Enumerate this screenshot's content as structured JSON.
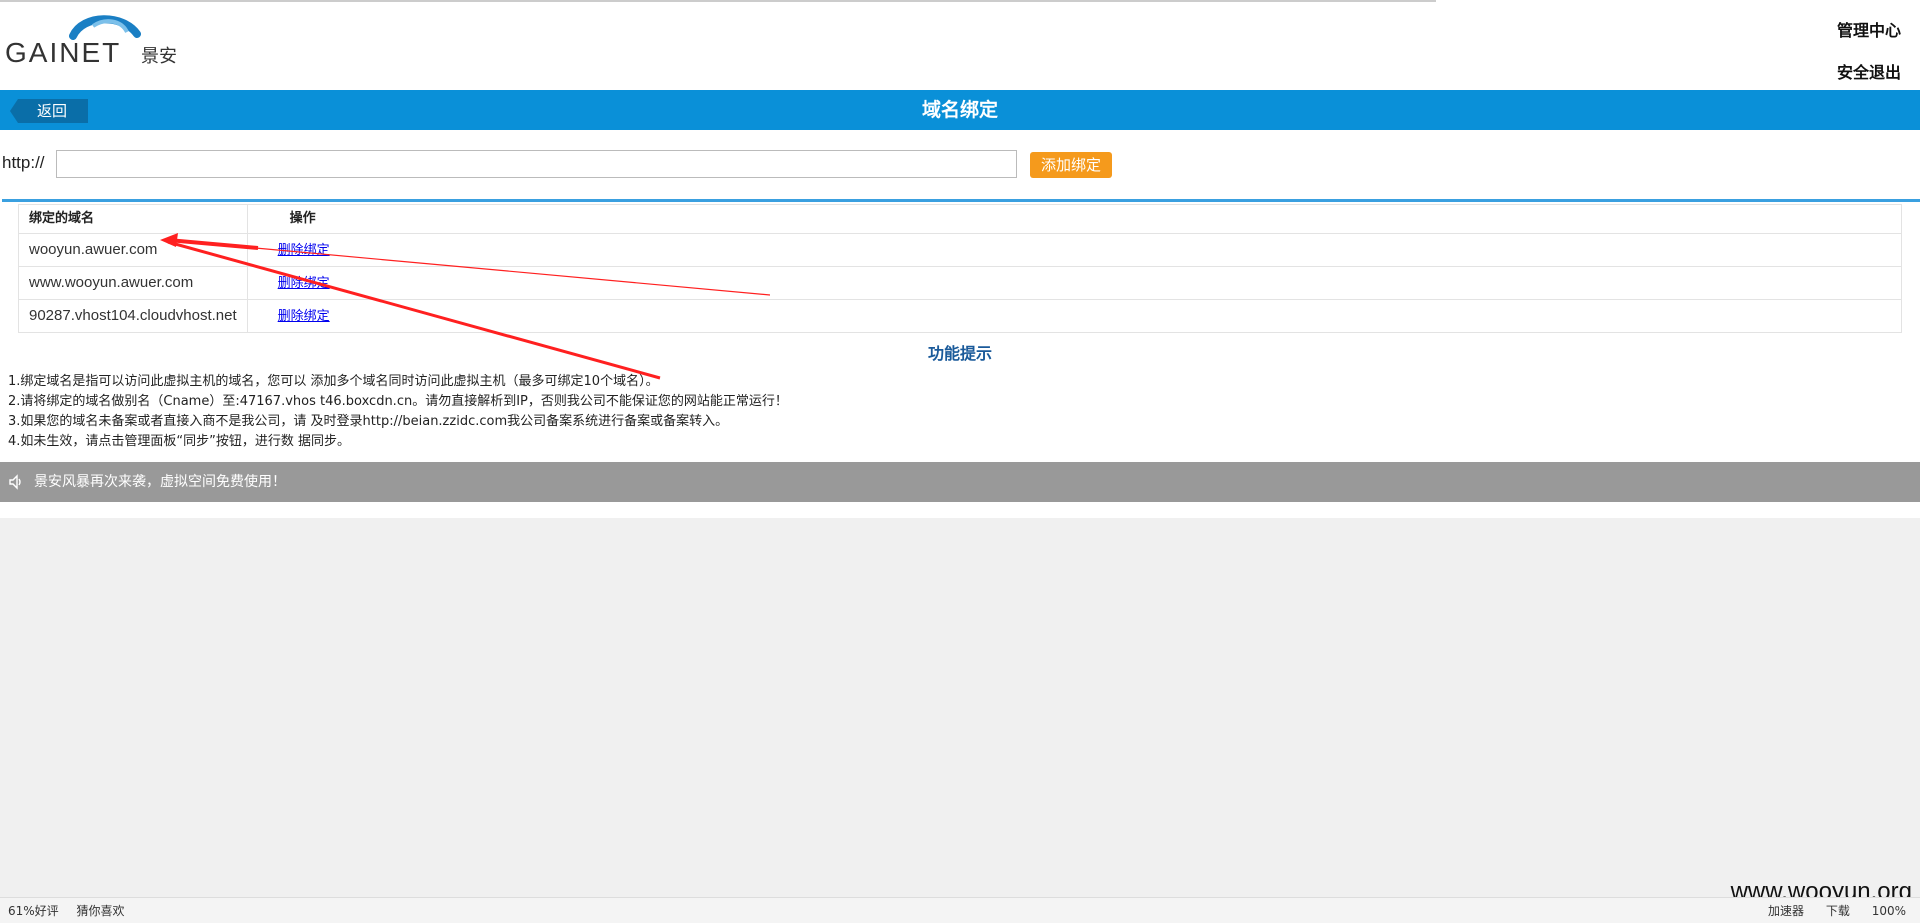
{
  "header": {
    "logo_text": "GAINET景安",
    "manage_center": "管理中心",
    "logout": "安全退出"
  },
  "titlebar": {
    "back_label": "返回",
    "title": "域名绑定"
  },
  "add_binding": {
    "prefix": "http://",
    "input_value": "",
    "button_label": "添加绑定"
  },
  "table": {
    "headers": [
      "绑定的域名",
      "操作"
    ],
    "rows": [
      {
        "domain": "wooyun.awuer.com",
        "action": "删除绑定"
      },
      {
        "domain": "www.wooyun.awuer.com",
        "action": "删除绑定"
      },
      {
        "domain": "90287.vhost104.cloudvhost.net",
        "action": "删除绑定"
      }
    ]
  },
  "tips": {
    "title": "功能提示",
    "items": [
      "1.绑定域名是指可以访问此虚拟主机的域名，您可以 添加多个域名同时访问此虚拟主机（最多可绑定10个域名）。",
      "2.请将绑定的域名做别名（Cname）至:47167.vhos t46.boxcdn.cn。请勿直接解析到IP，否则我公司不能保证您的网站能正常运行！",
      "3.如果您的域名未备案或者直接入商不是我公司，请 及时登录http://beian.zzidc.com我公司备案系统进行备案或备案转入。",
      "4.如未生效，请点击管理面板“同步”按钮，进行数 据同步。"
    ]
  },
  "notice": {
    "text": "景安风暴再次来袭，虚拟空间免费使用！"
  },
  "statusbar": {
    "left": [
      "61%好评",
      "猜你喜欢"
    ],
    "right": [
      "加速器",
      "下载",
      "100%"
    ]
  },
  "watermark": "www.wooyun.org",
  "colors": {
    "titlebar": "#0a90d8",
    "add_button": "#f59a1c",
    "notice_bar": "#999999",
    "annotation_arrow": "#ff0000"
  }
}
